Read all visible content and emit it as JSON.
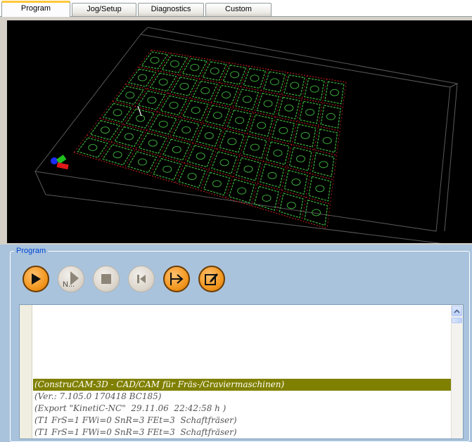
{
  "tabs": [
    {
      "label": "Program",
      "active": true
    },
    {
      "label": "Jog/Setup",
      "active": false
    },
    {
      "label": "Diagnostics",
      "active": false
    },
    {
      "label": "Custom",
      "active": false
    }
  ],
  "viewport": {
    "background": "#000000",
    "toolpath_colors": {
      "cut": "#3aa83a",
      "rapid": "#d42020"
    }
  },
  "program_group": {
    "title": "Program",
    "buttons": [
      {
        "name": "play-button",
        "icon": "play-icon",
        "enabled": true
      },
      {
        "name": "run-from-line-button",
        "icon": "next-line-icon",
        "label": "N...",
        "enabled": false
      },
      {
        "name": "stop-button",
        "icon": "stop-icon",
        "enabled": false
      },
      {
        "name": "rewind-button",
        "icon": "rewind-icon",
        "enabled": false
      },
      {
        "name": "load-button",
        "icon": "load-arrow-icon",
        "enabled": true
      },
      {
        "name": "edit-button",
        "icon": "edit-icon",
        "enabled": true
      }
    ]
  },
  "editor": {
    "highlight_color": "#808000",
    "lines": [
      {
        "text": "(ConstruCAM-3D - CAD/CAM für Fräs-/Graviermaschinen)",
        "highlighted": true
      },
      {
        "text": "(Ver.: 7.105.0 170418 BC185)",
        "highlighted": false
      },
      {
        "text": "(Export \"KinetiC-NC\"  29.11.06  22:42:58 h )",
        "highlighted": false
      },
      {
        "text": "(T1 FrS=1 FWi=0 SnR=3 FEt=3  Schaftfräser)",
        "highlighted": false
      },
      {
        "text": "(T1 FrS=1 FWi=0 SnR=3 FEt=3  Schaftfräser)",
        "highlighted": false
      }
    ]
  }
}
